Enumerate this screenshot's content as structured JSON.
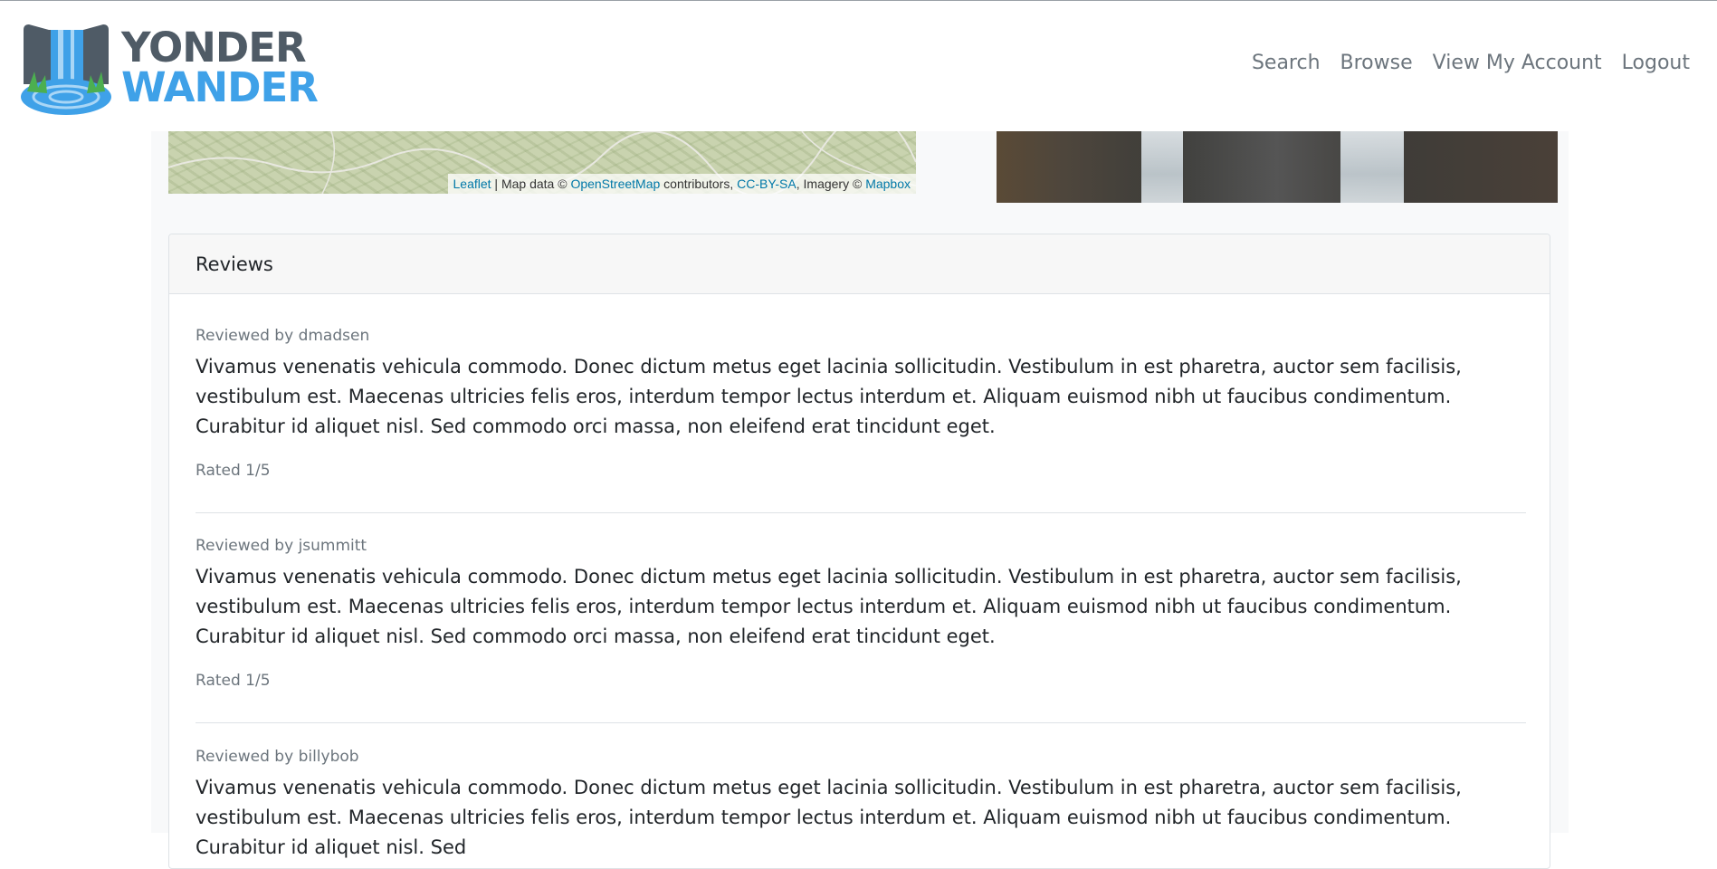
{
  "brand": {
    "line1": "YONDER",
    "line2": "WANDER"
  },
  "nav": {
    "items": [
      "Search",
      "Browse",
      "View My Account",
      "Logout"
    ]
  },
  "map": {
    "attribution": {
      "leaflet": "Leaflet",
      "sep1": " | Map data © ",
      "osm": "OpenStreetMap",
      "contrib": " contributors, ",
      "license": "CC-BY-SA",
      "imagery": ", Imagery © ",
      "mapbox": "Mapbox"
    }
  },
  "reviews": {
    "header": "Reviews",
    "items": [
      {
        "by": "Reviewed by dmadsen",
        "text": "Vivamus venenatis vehicula commodo. Donec dictum metus eget lacinia sollicitudin. Vestibulum in est pharetra, auctor sem facilisis, vestibulum est. Maecenas ultricies felis eros, interdum tempor lectus interdum et. Aliquam euismod nibh ut faucibus condimentum. Curabitur id aliquet nisl. Sed commodo orci massa, non eleifend erat tincidunt eget.",
        "rated": "Rated 1/5"
      },
      {
        "by": "Reviewed by jsummitt",
        "text": "Vivamus venenatis vehicula commodo. Donec dictum metus eget lacinia sollicitudin. Vestibulum in est pharetra, auctor sem facilisis, vestibulum est. Maecenas ultricies felis eros, interdum tempor lectus interdum et. Aliquam euismod nibh ut faucibus condimentum. Curabitur id aliquet nisl. Sed commodo orci massa, non eleifend erat tincidunt eget.",
        "rated": "Rated 1/5"
      },
      {
        "by": "Reviewed by billybob",
        "text": "Vivamus venenatis vehicula commodo. Donec dictum metus eget lacinia sollicitudin. Vestibulum in est pharetra, auctor sem facilisis, vestibulum est. Maecenas ultricies felis eros, interdum tempor lectus interdum et. Aliquam euismod nibh ut faucibus condimentum. Curabitur id aliquet nisl. Sed"
      }
    ]
  },
  "colors": {
    "brand_dark": "#4f5b66",
    "brand_blue": "#3fa1e8",
    "link": "#0078a8"
  }
}
